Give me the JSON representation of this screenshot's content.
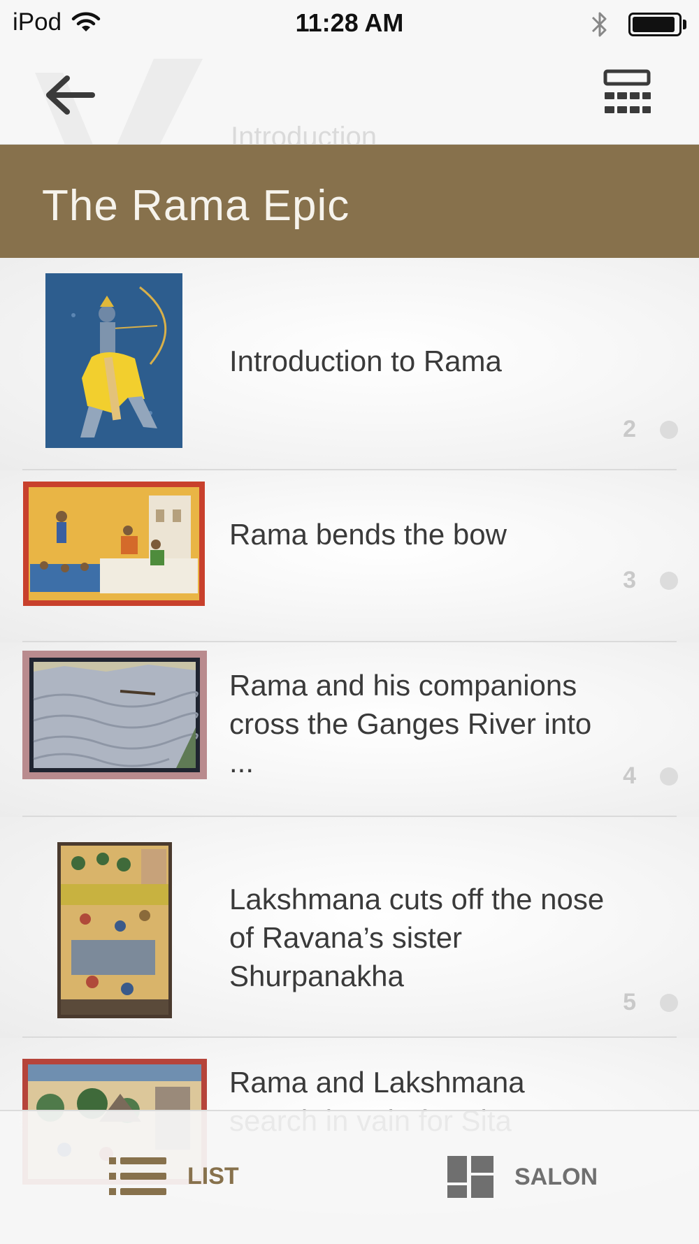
{
  "status_bar": {
    "carrier": "iPod",
    "time": "11:28 AM"
  },
  "nav": {
    "ghost_text": "Introduction"
  },
  "section": {
    "title": "The Rama Epic"
  },
  "items": [
    {
      "title": "Introduction to Rama",
      "number": "2"
    },
    {
      "title": "Rama bends the bow",
      "number": "3"
    },
    {
      "title": "Rama and his companions cross the Ganges River into ...",
      "number": "4"
    },
    {
      "title": "Lakshmana cuts off the nose of Ravana’s sister Shurpanakha",
      "number": "5"
    },
    {
      "title": "Rama and Lakshmana search in vain for Sita",
      "number": ""
    }
  ],
  "tabs": {
    "list_label": "LIST",
    "salon_label": "SALON"
  },
  "colors": {
    "accent": "#87714c",
    "active_tab": "#87714c",
    "inactive_tab": "#6f6f6f"
  }
}
